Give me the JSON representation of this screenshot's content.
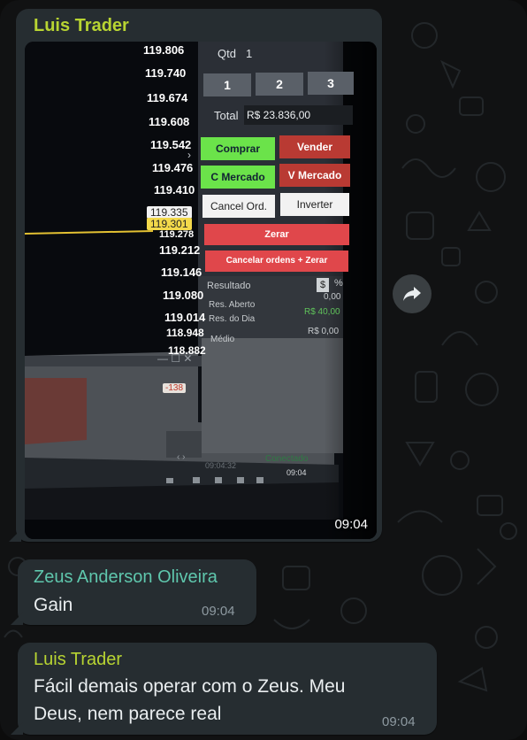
{
  "colors": {
    "bubble": "#262d31",
    "sender_luis": "#b8d432",
    "sender_zeus": "#5fc7ad",
    "buy_green": "#6be34a",
    "sell_red": "#b93a33",
    "zero_red": "#e0474b"
  },
  "messages": [
    {
      "sender": "Luis Trader",
      "type": "image",
      "time": "09:04",
      "screen": {
        "prices": [
          "119.806",
          "119.740",
          "119.674",
          "119.608",
          "119.542",
          "119.476",
          "119.410",
          "119.335",
          "119.301",
          "119.278",
          "119.212",
          "119.146",
          "119.080",
          "119.014",
          "118.948",
          "118.882"
        ],
        "qtd_label": "Qtd",
        "qtd_value": "1",
        "qty_buttons": [
          "1",
          "2",
          "3"
        ],
        "total_label": "Total",
        "total_value": "R$ 23.836,00",
        "btn_buy": "Comprar",
        "btn_sell": "Vender",
        "btn_buy_market": "C Mercado",
        "btn_sell_market": "V Mercado",
        "btn_cancel_ord": "Cancel Ord.",
        "btn_invert": "Inverter",
        "btn_zero": "Zerar",
        "btn_cancel_zero": "Cancelar ordens + Zerar",
        "result_label": "Resultado",
        "result_currency": "$",
        "result_percent": "%",
        "open_label": "Res. Aberto",
        "open_value": "0,00",
        "day_label": "Res. do Dia",
        "day_value": "R$ 40,00",
        "avg_label": "Médio",
        "avg_value": "R$ 0,00",
        "badge": "-138",
        "status_time": "09:04:32",
        "status_text": "Conectado",
        "clock": "09:04"
      }
    },
    {
      "sender": "Zeus Anderson Oliveira",
      "type": "text",
      "text": "Gain",
      "time": "09:04"
    },
    {
      "sender": "Luis Trader",
      "type": "text",
      "text_line1": "Fácil demais operar com o Zeus. Meu",
      "text_line2": "Deus, nem parece real",
      "time": "09:04"
    }
  ]
}
